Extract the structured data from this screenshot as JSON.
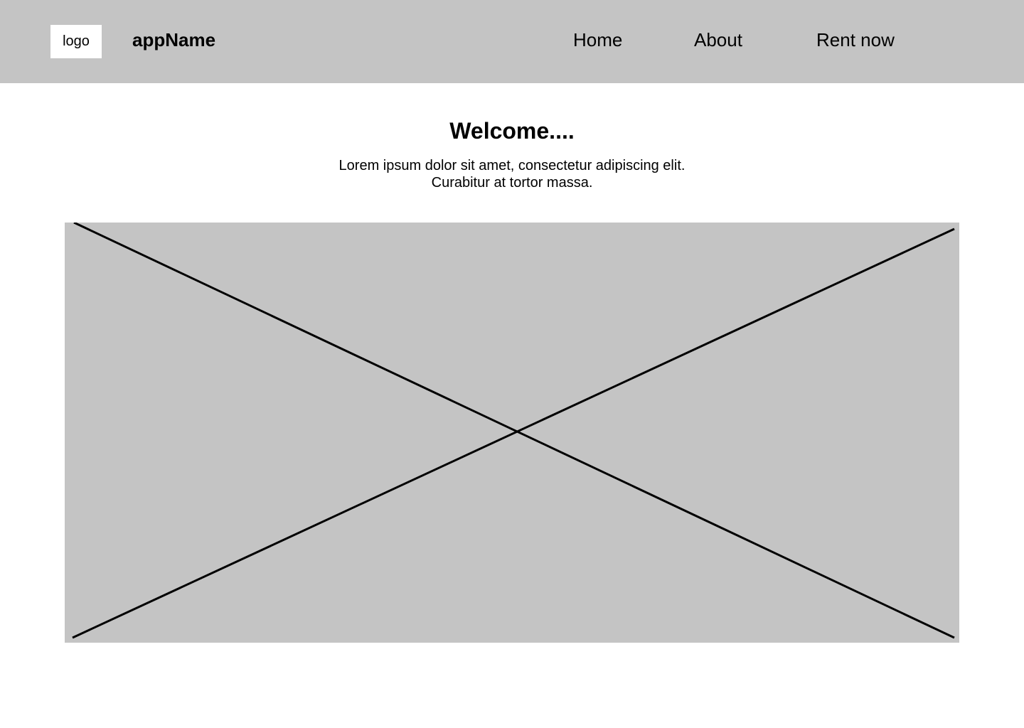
{
  "header": {
    "logo_label": "logo",
    "app_name": "appName",
    "nav": {
      "home": "Home",
      "about": "About",
      "rent_now": "Rent now"
    },
    "background_color": "#c4c4c4"
  },
  "main": {
    "title": "Welcome....",
    "description": "Lorem ipsum dolor sit amet, consectetur adipiscing elit. Curabitur at tortor massa."
  },
  "hero": {
    "placeholder_color": "#c4c4c4"
  }
}
